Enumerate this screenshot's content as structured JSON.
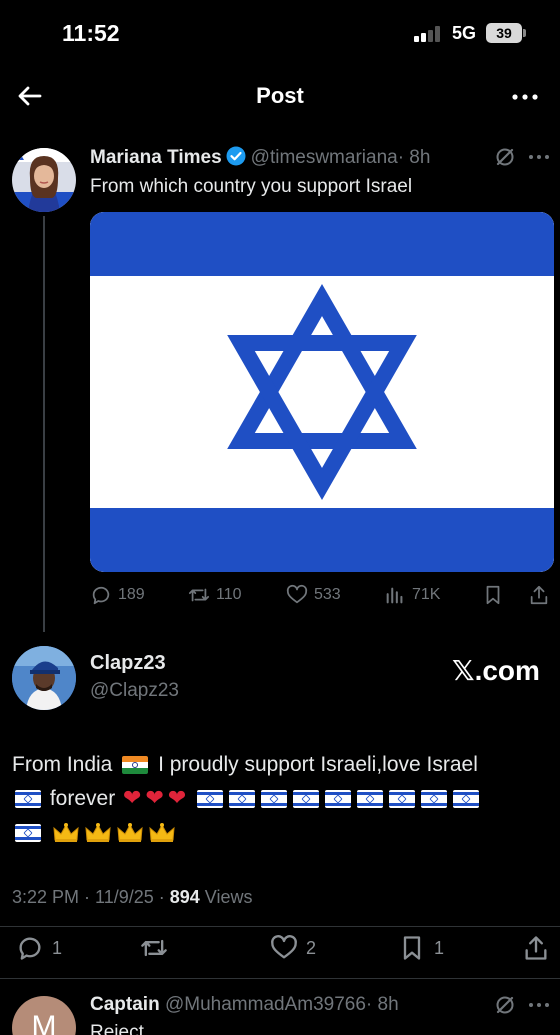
{
  "status_bar": {
    "time": "11:52",
    "network": "5G",
    "battery": "39"
  },
  "header": {
    "title": "Post"
  },
  "original_post": {
    "author_name": "Mariana Times",
    "handle": "@timeswmariana",
    "age": "· 8h",
    "text": "From which country you support Israel",
    "stats": {
      "replies": "189",
      "reposts": "110",
      "likes": "533",
      "views": "71K"
    }
  },
  "reply": {
    "author_name": "Clapz23",
    "handle": "@Clapz23",
    "watermark": ".com",
    "text_part1": "From India",
    "text_part2": "I proudly support Israeli,love Israel",
    "text_part3": "forever",
    "timestamp_prefix": "3:22 PM · 11/9/25 · ",
    "views_count": "894",
    "views_label": " Views",
    "stats": {
      "replies": "1",
      "likes": "2",
      "bookmarks": "1"
    }
  },
  "next_post": {
    "avatar_letter": "M",
    "author_name": "Captain",
    "handle": "@MuhammadAm39766",
    "age": "· 8h",
    "text": "Reject"
  },
  "colors": {
    "background": "#000000",
    "muted": "#71767b",
    "israel_blue": "#1f4fc4",
    "verified_blue": "#1d9bf0",
    "heart_red": "#e0243a"
  }
}
